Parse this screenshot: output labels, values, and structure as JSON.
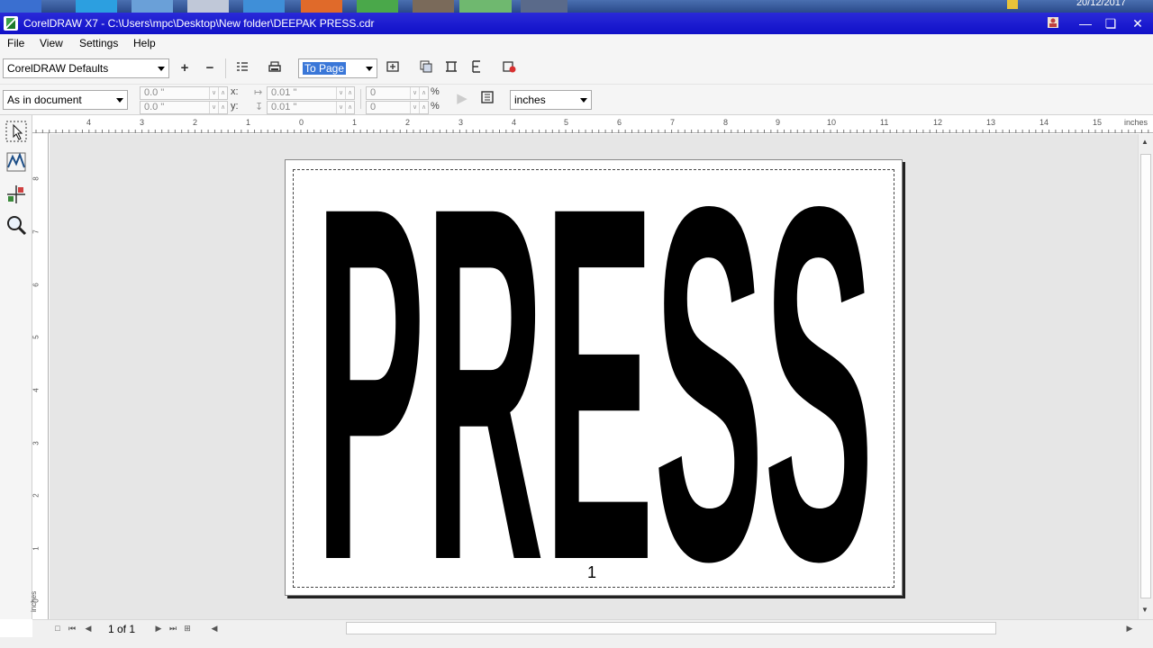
{
  "taskbar": {
    "clock": "20/12/2017"
  },
  "window": {
    "title": "CorelDRAW X7 - C:\\Users\\mpc\\Desktop\\New folder\\DEEPAK PRESS.cdr"
  },
  "menu": {
    "items": [
      "File",
      "View",
      "Settings",
      "Help"
    ]
  },
  "toolbar1": {
    "preset": "CorelDRAW Defaults",
    "zoom": "To Page"
  },
  "toolbar2": {
    "scope": "As in document",
    "x": "0.0 \"",
    "y": "0.0 \"",
    "x_label": "x:",
    "y_label": "y:",
    "w": "0.01 \"",
    "h": "0.01 \"",
    "p1": "0",
    "p2": "0",
    "pct": "%",
    "units": "inches"
  },
  "rulers": {
    "h_ticks": [
      "4",
      "3",
      "2",
      "1",
      "0",
      "1",
      "2",
      "3",
      "4",
      "5",
      "6",
      "7",
      "8",
      "9",
      "10",
      "11",
      "12",
      "13",
      "14",
      "15"
    ],
    "h_unit": "inches",
    "v_ticks": [
      "8",
      "7",
      "6",
      "5",
      "4",
      "3",
      "2",
      "1",
      "0"
    ],
    "v_unit": "inches"
  },
  "document": {
    "text": "PRESS",
    "page_label": "1"
  },
  "nav": {
    "page_count": "1 of 1"
  },
  "icons": [
    "pick-tool-icon",
    "shape-tool-icon",
    "transform-tool-icon",
    "zoom-tool-icon"
  ]
}
